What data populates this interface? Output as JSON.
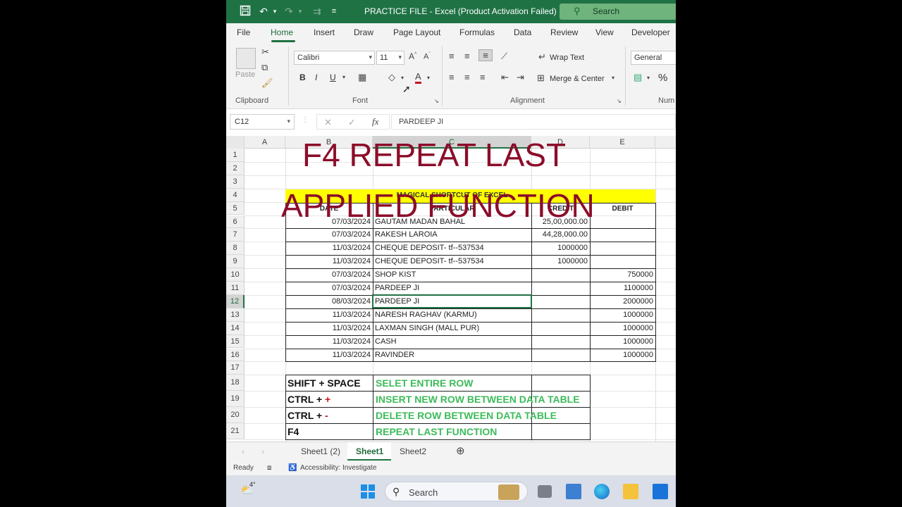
{
  "titlebar": {
    "title": "PRACTICE FILE  -  Excel (Product Activation Failed)",
    "search_placeholder": "Search"
  },
  "ribbon_tabs": [
    "File",
    "Home",
    "Insert",
    "Draw",
    "Page Layout",
    "Formulas",
    "Data",
    "Review",
    "View",
    "Developer"
  ],
  "ribbon": {
    "paste_label": "Paste",
    "clipboard_label": "Clipboard",
    "font_name": "Calibri",
    "font_size": "11",
    "font_label": "Font",
    "bold": "B",
    "italic": "I",
    "underline": "U",
    "wrap_text": "Wrap Text",
    "merge_center": "Merge & Center",
    "alignment_label": "Alignment",
    "number_format": "General",
    "number_label": "Num",
    "percent": "%"
  },
  "formula_bar": {
    "name_box": "C12",
    "formula": "PARDEEP JI"
  },
  "columns": [
    "A",
    "B",
    "C",
    "D",
    "E"
  ],
  "rows": [
    "1",
    "2",
    "3",
    "4",
    "5",
    "6",
    "7",
    "8",
    "9",
    "10",
    "11",
    "12",
    "13",
    "14",
    "15",
    "16",
    "17",
    "18",
    "19",
    "20",
    "21"
  ],
  "table": {
    "heading": "MAGICAL SHORTCUT OF EXCEL",
    "headers": [
      "DATE",
      "PARTICULAR",
      "CREDIT",
      "DEBIT"
    ],
    "rows": [
      [
        "07/03/2024",
        "GAUTAM MADAN BAHAL",
        "25,00,000.00",
        ""
      ],
      [
        "07/03/2024",
        "RAKESH LAROIA",
        "44,28,000.00",
        ""
      ],
      [
        "11/03/2024",
        "CHEQUE DEPOSIT-  tf--537534",
        "1000000",
        ""
      ],
      [
        "11/03/2024",
        "CHEQUE DEPOSIT-  tf--537534",
        "1000000",
        ""
      ],
      [
        "07/03/2024",
        "SHOP KIST",
        "",
        "750000"
      ],
      [
        "07/03/2024",
        "PARDEEP JI",
        "",
        "1100000"
      ],
      [
        "08/03/2024",
        "PARDEEP JI",
        "",
        "2000000"
      ],
      [
        "11/03/2024",
        "NARESH RAGHAV (KARMU)",
        "",
        "1000000"
      ],
      [
        "11/03/2024",
        "LAXMAN SINGH (MALL PUR)",
        "",
        "1000000"
      ],
      [
        "11/03/2024",
        "CASH",
        "",
        "1000000"
      ],
      [
        "11/03/2024",
        "RAVINDER",
        "",
        "1000000"
      ]
    ]
  },
  "shortcuts": [
    {
      "key_prefix": "SHIFT + SPACE",
      "key_suffix": "",
      "action": "SELET ENTIRE ROW"
    },
    {
      "key_prefix": "CTRL + ",
      "key_suffix": "+",
      "action": "INSERT NEW ROW BETWEEN  DATA TABLE"
    },
    {
      "key_prefix": "CTRL + ",
      "key_suffix": "-",
      "action": "DELETE ROW BETWEEN DATA TABLE"
    },
    {
      "key_prefix": "F4",
      "key_suffix": "",
      "action": "REPEAT LAST FUNCTION"
    }
  ],
  "overlay": {
    "line1": "F4 REPEAT LAST",
    "line2": "APPLIED FUNCTION"
  },
  "sheet_tabs": [
    "Sheet1 (2)",
    "Sheet1",
    "Sheet2"
  ],
  "status": {
    "ready": "Ready",
    "accessibility": "Accessibility: Investigate"
  },
  "taskbar": {
    "weather": "4°",
    "search": "Search"
  },
  "colors": {
    "excel_green": "#1f7244",
    "overlay_red": "#8b0d2a",
    "heading_yellow": "#ffff00",
    "action_green": "#3dbb5a"
  }
}
